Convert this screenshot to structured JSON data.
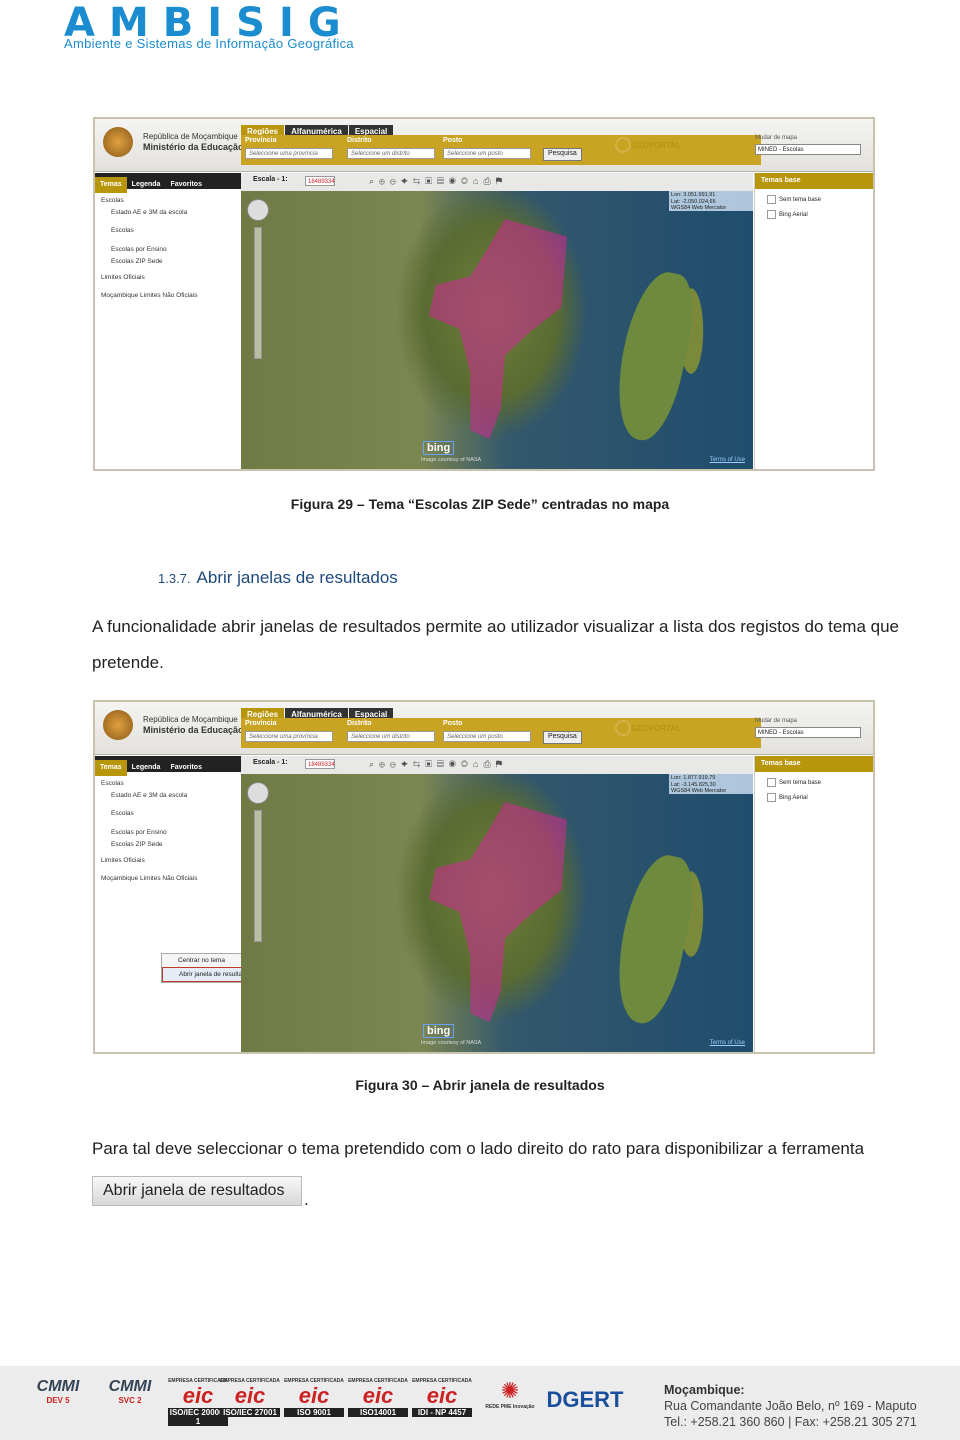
{
  "header": {
    "logo": "AMBISIG",
    "tagline": "Ambiente e Sistemas de Informação Geográfica"
  },
  "gis": {
    "republic": "República de Moçambique",
    "ministry": "Ministério da Educação",
    "nav_tabs": [
      "Regiões",
      "Alfanumérica",
      "Espacial"
    ],
    "filter_labels": [
      "Província",
      "Distrito",
      "Posto"
    ],
    "filter_placeholders": [
      "Seleccione uma província",
      "Seleccione um distrito",
      "Seleccione um posto"
    ],
    "search_button": "Pesquisa",
    "geoportal": "GEOPORTAL",
    "map_select_label": "Mudar de mapa",
    "map_select_value": "MINED - Escolas",
    "left_tabs": [
      "Temas",
      "Legenda",
      "Favoritos"
    ],
    "tree": [
      "Escolas",
      "Estado AE e 3M da escola",
      "Escolas",
      "Escolas por Ensino",
      "Escolas ZIP Sede",
      "Limites Oficiais",
      "Moçambique Limites Não Oficiais"
    ],
    "scale_label": "Escala - 1:",
    "scale_value": "18489334",
    "base_title": "Temas base",
    "base_items": [
      "Sem tema base",
      "Bing Aerial"
    ],
    "coords1": [
      "Lon: 3.051.991,91",
      "Lat: -2.050.024,65",
      "WGS84 Web Mercator"
    ],
    "coords2": [
      "Lon: 1.877.919,79",
      "Lat: -3.145.825,30",
      "WGS84 Web Mercator"
    ],
    "bing": "bing",
    "image_courtesy": "Image courtesy of NASA",
    "terms": "Terms of Use",
    "context_menu": [
      "Centrar no tema",
      "Abrir janela de resultados"
    ]
  },
  "captions": {
    "fig29": "Figura 29 – Tema “Escolas ZIP Sede” centradas no mapa",
    "fig30": "Figura 30 – Abrir janela de resultados"
  },
  "section": {
    "number": "1.3.7.",
    "title": "Abrir janelas de resultados"
  },
  "paragraphs": {
    "p1": "A funcionalidade abrir janelas de resultados permite ao utilizador visualizar a lista dos registos do tema que pretende.",
    "p2": "Para tal deve seleccionar o tema pretendido com o lado direito do rato para disponibilizar a ferramenta"
  },
  "tool_button": "Abrir janela de resultados",
  "footer": {
    "certs": [
      {
        "name": "CMMI",
        "sub": "DEV 5"
      },
      {
        "name": "CMMI",
        "sub": "SVC 2"
      },
      {
        "top": "EMPRESA CERTIFICADA",
        "mark": "eic",
        "code": "ISO/IEC 20000-1"
      },
      {
        "top": "EMPRESA CERTIFICADA",
        "mark": "eic",
        "code": "ISO/IEC 27001"
      },
      {
        "top": "EMPRESA CERTIFICADA",
        "mark": "eic",
        "code": "ISO 9001"
      },
      {
        "top": "EMPRESA CERTIFICADA",
        "mark": "eic",
        "code": "ISO14001"
      },
      {
        "top": "EMPRESA CERTIFICADA",
        "mark": "eic",
        "code": "IDI - NP 4457"
      }
    ],
    "rede": "REDE PME Inovação",
    "dgert": "DGERT",
    "country": "Moçambique:",
    "address": "Rua Comandante João Belo, nº 169 - Maputo",
    "phone": "Tel.: +258.21 360 860",
    "fax": "Fax: +258.21 305 271"
  }
}
